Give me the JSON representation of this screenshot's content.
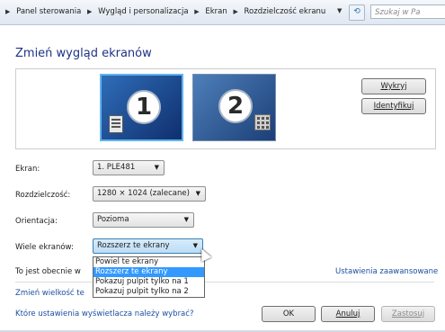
{
  "address_bar": {
    "breadcrumbs": [
      "Panel sterowania",
      "Wygląd i personalizacja",
      "Ekran",
      "Rozdzielczość ekranu"
    ],
    "search_placeholder": "Szukaj w Pa"
  },
  "page_title": "Zmień wygląd ekranów",
  "monitors": {
    "items": [
      {
        "number": "1",
        "selected": true
      },
      {
        "number": "2",
        "selected": false
      }
    ],
    "detect_button": "Wykryj",
    "identify_button": "Identyfikuj"
  },
  "settings": {
    "display": {
      "label": "Ekran:",
      "value": "1. PLE481"
    },
    "resolution": {
      "label": "Rozdzielczość:",
      "value": "1280 × 1024 (zalecane)"
    },
    "orientation": {
      "label": "Orientacja:",
      "value": "Pozioma"
    },
    "multiple": {
      "label": "Wiele ekranów:",
      "value": "Rozszerz te ekrany"
    }
  },
  "multiple_dropdown": {
    "options": [
      "Powiel te ekrany",
      "Rozszerz te ekrany",
      "Pokazuj pulpit tylko na 1",
      "Pokazuj pulpit tylko na 2"
    ],
    "selected_index": 1
  },
  "current_text": "To jest obecnie w",
  "advanced_link": "Ustawienia zaawansowane",
  "change_size_link": "Zmień wielkość te",
  "which_settings_link": "Które ustawienia wyświetlacza należy wybrać?",
  "buttons": {
    "ok": "OK",
    "cancel": "Anuluj",
    "apply": "Zastosuj"
  },
  "colors": {
    "title": "#1e3287",
    "link": "#1e4ea0",
    "selection": "#3399ff"
  }
}
